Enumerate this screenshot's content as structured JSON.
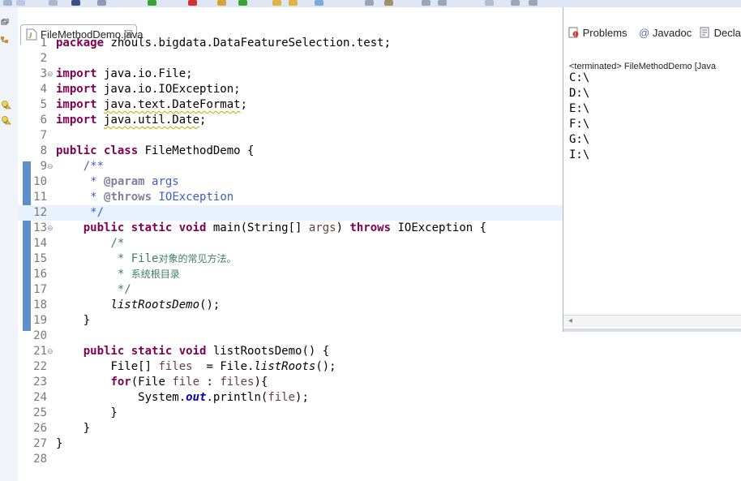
{
  "editor": {
    "tab_label": "FileMethodDemo.java",
    "tab_close": "☒",
    "lines": [
      {
        "n": "1"
      },
      {
        "n": "2"
      },
      {
        "n": "3"
      },
      {
        "n": "4"
      },
      {
        "n": "5"
      },
      {
        "n": "6"
      },
      {
        "n": "7"
      },
      {
        "n": "8"
      },
      {
        "n": "9"
      },
      {
        "n": "10"
      },
      {
        "n": "11"
      },
      {
        "n": "12"
      },
      {
        "n": "13"
      },
      {
        "n": "14"
      },
      {
        "n": "15"
      },
      {
        "n": "16"
      },
      {
        "n": "17"
      },
      {
        "n": "18"
      },
      {
        "n": "19"
      },
      {
        "n": "20"
      },
      {
        "n": "21"
      },
      {
        "n": "22"
      },
      {
        "n": "23"
      },
      {
        "n": "24"
      },
      {
        "n": "25"
      },
      {
        "n": "26"
      },
      {
        "n": "27"
      },
      {
        "n": "28"
      }
    ],
    "code": {
      "l1_kw": "package",
      "l1_rest": " zhouls.bigdata.DataFeatureSelection.test;",
      "l3_kw": "import",
      "l3_rest": " java.io.File;",
      "l4_kw": "import",
      "l4_rest": " java.io.IOException;",
      "l5_kw": "import",
      "l5_sp": " ",
      "l5_rest": "java.text.DateFormat",
      "l5_end": ";",
      "l6_kw": "import",
      "l6_sp": " ",
      "l6_rest": "java.util.Date",
      "l6_end": ";",
      "l8_kw": "public class",
      "l8_rest": " FileMethodDemo {",
      "l9": "    /**",
      "l10_a": "     * ",
      "l10_tag": "@param",
      "l10_b": " args",
      "l11_a": "     * ",
      "l11_tag": "@throws",
      "l11_b": " IOException",
      "l12": "     */",
      "l13_kw": "public static void",
      "l13_a": " main(String[] ",
      "l13_var": "args",
      "l13_b": ") ",
      "l13_kw2": "throws",
      "l13_c": " IOException {",
      "l14": "        /*",
      "l15_a": "         * File",
      "l15_cjk": "对象的常见方法。",
      "l16_a": "         * ",
      "l16_cjk": "系统根目录",
      "l17": "         */",
      "l18_call": "listRootsDemo",
      "l18_rest": "();",
      "l19": "    }",
      "l21_kw": "public static void",
      "l21_rest": " listRootsDemo() {",
      "l22_a": "File[] ",
      "l22_var": "files",
      "l22_b": "  = File.",
      "l22_call": "listRoots",
      "l22_c": "();",
      "l23_kw": "for",
      "l23_a": "(File ",
      "l23_var": "file",
      "l23_b": " : ",
      "l23_var2": "files",
      "l23_c": "){",
      "l24_a": "System.",
      "l24_fld": "out",
      "l24_b": ".println(",
      "l24_var": "file",
      "l24_c": ");",
      "l25": "        }",
      "l26": "    }",
      "l27": "}"
    }
  },
  "console": {
    "tabs": [
      {
        "label": "Problems",
        "icon": "problems-icon"
      },
      {
        "label": "Javadoc",
        "icon": "at-icon"
      },
      {
        "label": "Decla",
        "icon": "declaration-icon"
      }
    ],
    "header": "<terminated> FileMethodDemo [Java",
    "output": [
      "C:\\",
      "D:\\",
      "E:\\",
      "F:\\",
      "G:\\",
      "I:\\"
    ]
  },
  "colors": {
    "keyword": "#7f0055",
    "javadoc": "#3f5fbf",
    "comment": "#3f7f5f",
    "field": "#0000c0",
    "current_line": "#e8f2fe"
  }
}
